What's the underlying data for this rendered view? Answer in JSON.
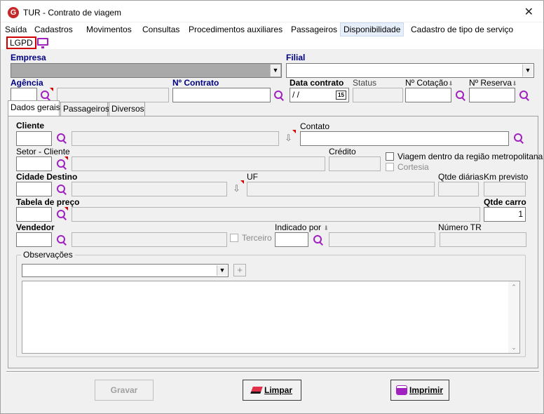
{
  "window": {
    "title": "TUR - Contrato de viagem",
    "close_glyph": "✕"
  },
  "menu": {
    "items": [
      "Saída",
      "Cadastros",
      "Movimentos",
      "Consultas",
      "Procedimentos auxiliares",
      "Passageiros",
      "Disponibilidade",
      "Cadastro de tipo de serviço"
    ],
    "active": "Disponibilidade",
    "lgpd": "LGPD"
  },
  "header": {
    "empresa_label": "Empresa",
    "empresa_value": "",
    "filial_label": "Filial",
    "filial_value": "",
    "agencia_label": "Agência",
    "contrato_label": "Nº Contrato",
    "data_contrato_label": "Data contrato",
    "data_contrato_value": " /  /",
    "calendar_glyph": "15",
    "status_label": "Status",
    "cotacao_label": "Nº Cotação",
    "reserva_label": "Nº Reserva"
  },
  "tabs": [
    "Dados gerais",
    "Passageiros",
    "Diversos"
  ],
  "form": {
    "cliente_label": "Cliente",
    "contato_label": "Contato",
    "setor_label": "Setor - Cliente",
    "credito_label": "Crédito",
    "viagem_label": "Viagem dentro da região metropolitana",
    "cortesia_label": "Cortesia",
    "cidade_label": "Cidade Destino",
    "uf_label": "UF",
    "qtde_diarias_label": "Qtde diárias",
    "km_label": "Km previsto",
    "tabela_label": "Tabela de preço",
    "qtde_carro_label": "Qtde carro",
    "qtde_carro_value": "1",
    "vendedor_label": "Vendedor",
    "terceiro_label": "Terceiro",
    "indicado_label": "Indicado por",
    "numero_tr_label": "Número TR",
    "observacoes_label": "Observações",
    "plus_glyph": "+"
  },
  "buttons": {
    "gravar": "Gravar",
    "limpar": "Limpar",
    "imprimir": "Imprimir"
  }
}
